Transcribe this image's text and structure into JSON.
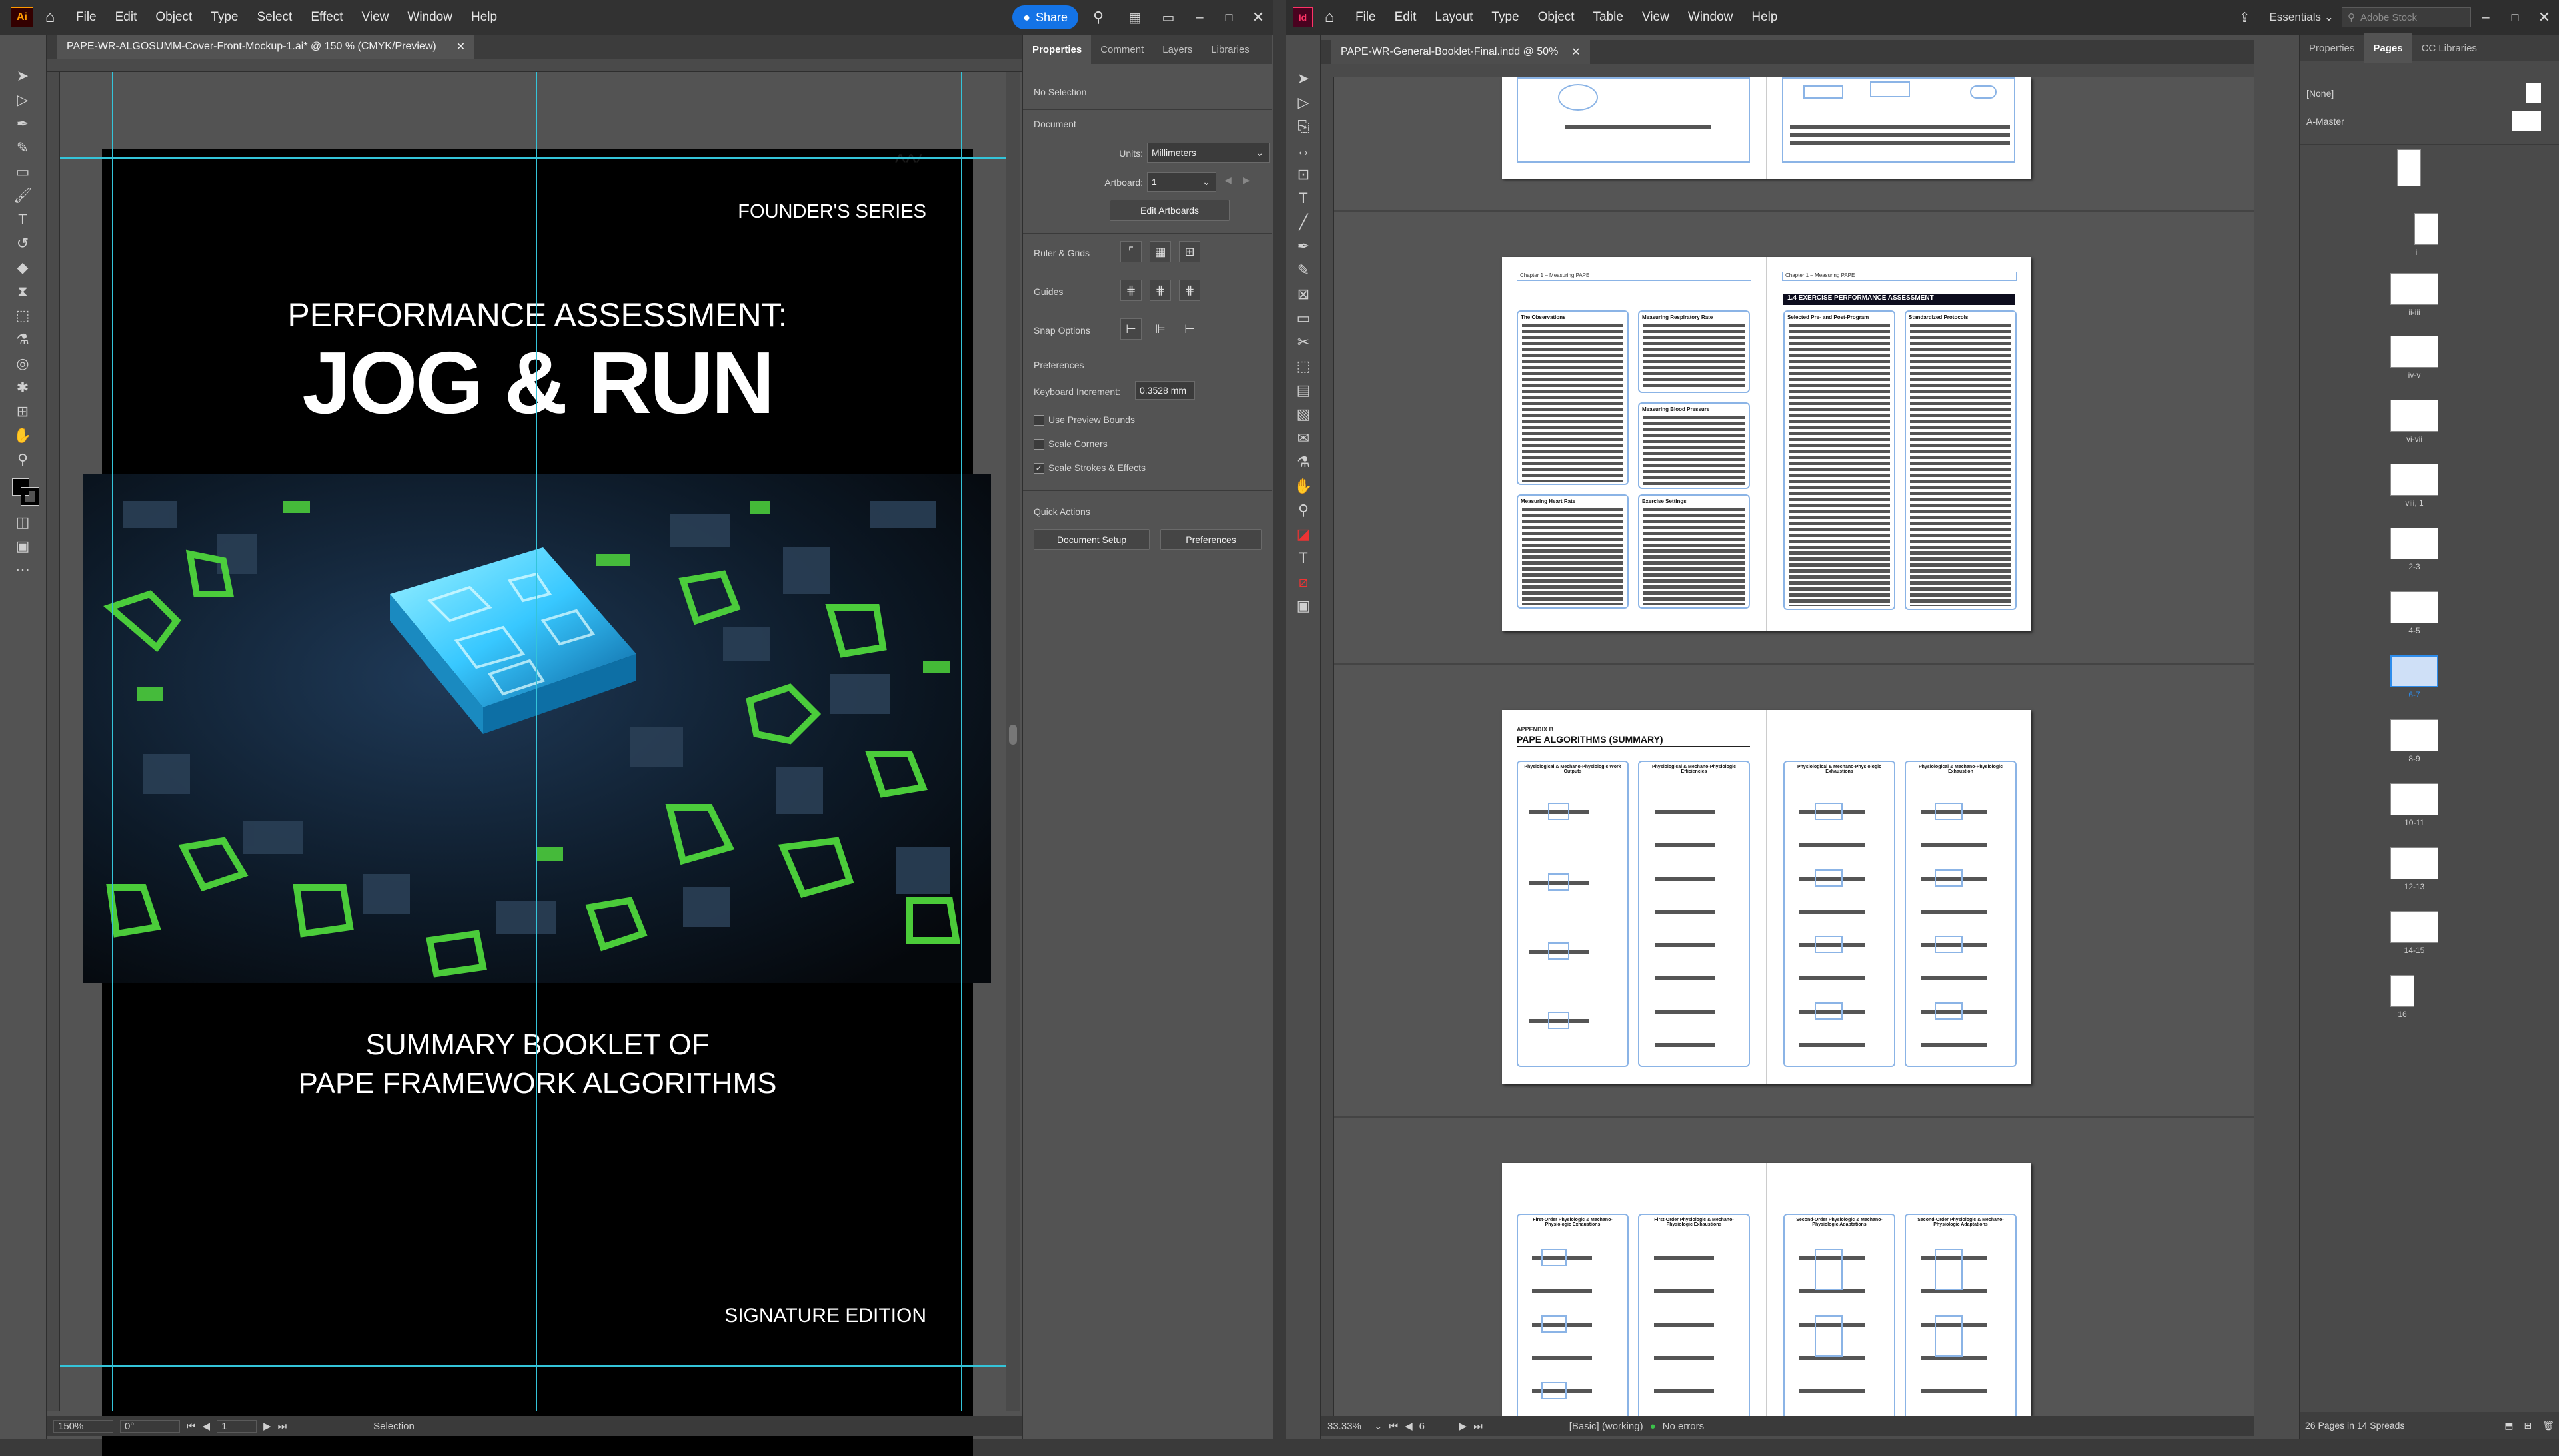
{
  "illustrator": {
    "app_badge": "Ai",
    "menu": [
      "File",
      "Edit",
      "Object",
      "Type",
      "Select",
      "Effect",
      "View",
      "Window",
      "Help"
    ],
    "share_label": "Share",
    "doc_tab": "PAPE-WR-ALGOSUMM-Cover-Front-Mockup-1.ai* @ 150 % (CMYK/Preview)",
    "cover": {
      "series": "FOUNDER'S SERIES",
      "headline_small": "PERFORMANCE ASSESSMENT:",
      "headline_big": "JOG & RUN",
      "subtitle_1": "SUMMARY BOOKLET OF",
      "subtitle_2": "PAPE FRAMEWORK ALGORITHMS",
      "edition": "SIGNATURE EDITION"
    },
    "status": {
      "zoom": "150%",
      "rotation": "0°",
      "artboard": "1",
      "tool": "Selection"
    }
  },
  "properties": {
    "tabs": [
      "Properties",
      "Comment",
      "Layers",
      "Libraries"
    ],
    "no_selection": "No Selection",
    "document_heading": "Document",
    "units_label": "Units:",
    "units_value": "Millimeters",
    "artboard_label": "Artboard:",
    "artboard_value": "1",
    "edit_artboards": "Edit Artboards",
    "ruler_grids": "Ruler & Grids",
    "guides": "Guides",
    "snap_options": "Snap Options",
    "preferences_heading": "Preferences",
    "keyboard_increment_label": "Keyboard Increment:",
    "keyboard_increment_value": "0.3528 mm",
    "use_preview_bounds": "Use Preview Bounds",
    "scale_corners": "Scale Corners",
    "scale_strokes": "Scale Strokes & Effects",
    "quick_actions": "Quick Actions",
    "document_setup": "Document Setup",
    "preferences_btn": "Preferences"
  },
  "indesign": {
    "app_badge": "Id",
    "menu": [
      "File",
      "Edit",
      "Layout",
      "Type",
      "Object",
      "Table",
      "View",
      "Window",
      "Help"
    ],
    "workspace": "Essentials",
    "search_placeholder": "Adobe Stock",
    "doc_tab": "PAPE-WR-General-Booklet-Final.indd @ 50%",
    "spread2": {
      "header_left": "Chapter 1 – Measuring PAPE",
      "header_right": "Chapter 1 – Measuring PAPE",
      "heading_right": "1.4 EXERCISE PERFORMANCE ASSESSMENT",
      "box_obs": "The Observations",
      "box_resp": "Measuring Respiratory Rate",
      "box_bp": "Measuring Blood Pressure",
      "box_hr": "Measuring Heart Rate",
      "box_ex": "Exercise Settings",
      "box_pre": "Selected Pre- and Post-Program",
      "box_std": "Standardized Protocols"
    },
    "spread3": {
      "appendix": "APPENDIX B",
      "title": "PAPE ALGORITHMS (SUMMARY)",
      "col1": "Physiological & Mechano-Physiologic Work Outputs",
      "col2": "Physiological & Mechano-Physiologic Efficiencies",
      "col3": "Physiological & Mechano-Physiologic Exhaustions",
      "col4": "Physiological & Mechano-Physiologic Exhaustion"
    },
    "spread4": {
      "col1": "First-Order Physiologic & Mechano-Physiologic Exhaustions",
      "col2": "First-Order Physiologic & Mechano-Physiologic Exhaustions",
      "col3": "Second-Order Physiologic & Mechano-Physiologic Adaptations",
      "col4": "Second-Order Physiologic & Mechano-Physiologic Adaptations"
    },
    "status": {
      "zoom": "33.33%",
      "page": "6",
      "preflight": "[Basic] (working)",
      "errors": "No errors"
    }
  },
  "pages_panel": {
    "tabs": [
      "Properties",
      "Pages",
      "CC Libraries"
    ],
    "none": "[None]",
    "master": "A-Master",
    "labels": [
      "i",
      "ii-iii",
      "iv-v",
      "vi-vii",
      "viii, 1",
      "2-3",
      "4-5",
      "6-7",
      "8-9",
      "10-11",
      "12-13",
      "14-15",
      "16"
    ],
    "footer": "26 Pages in 14 Spreads"
  }
}
